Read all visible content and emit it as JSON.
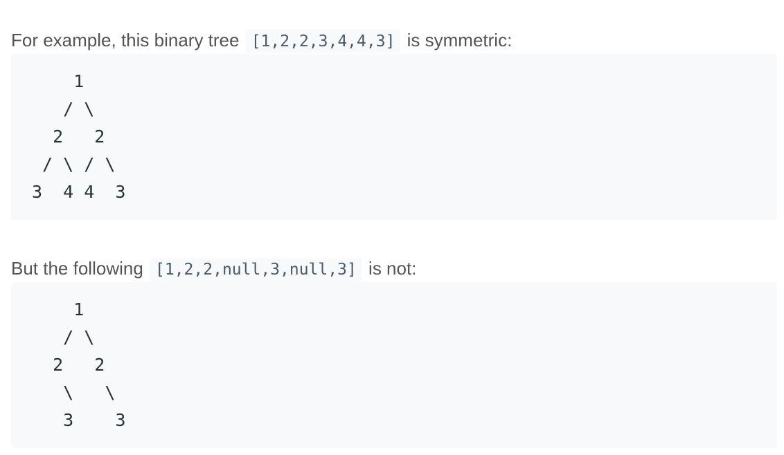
{
  "paragraph_1": {
    "prefix": "For example, this binary tree ",
    "code": "[1,2,2,3,4,4,3]",
    "suffix": " is symmetric:"
  },
  "code_block_1": "    1\n   / \\\n  2   2\n / \\ / \\\n3  4 4  3",
  "paragraph_2": {
    "prefix": "But the following ",
    "code": "[1,2,2,null,3,null,3]",
    "suffix": " is not:"
  },
  "code_block_2": "    1\n   / \\\n  2   2\n   \\   \\\n   3    3"
}
